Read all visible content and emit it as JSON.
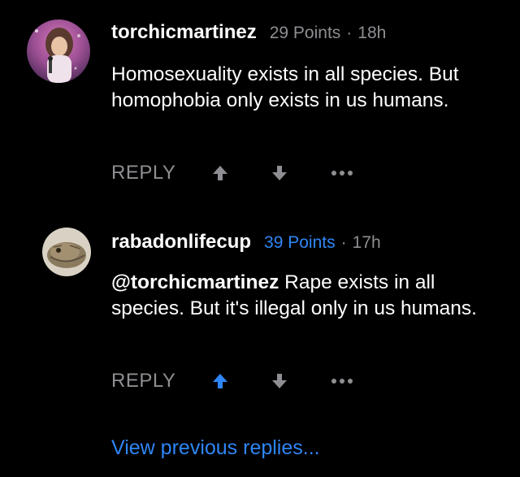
{
  "comments": [
    {
      "username": "torchicmartinez",
      "points": "29 Points",
      "separator": "·",
      "time": "18h",
      "text": "Homosexuality exists in all species. But homophobia only exists in us humans.",
      "reply_label": "REPLY",
      "upvoted": false
    },
    {
      "username": "rabadonlifecup",
      "points": "39 Points",
      "separator": "·",
      "time": "17h",
      "mention": "@torchicmartinez",
      "text": " Rape exists in all species. But it's illegal only in us humans.",
      "reply_label": "REPLY",
      "upvoted": true
    }
  ],
  "view_previous": "View previous replies...",
  "colors": {
    "background": "#000000",
    "muted": "#8e8e93",
    "accent": "#2f86f6"
  }
}
